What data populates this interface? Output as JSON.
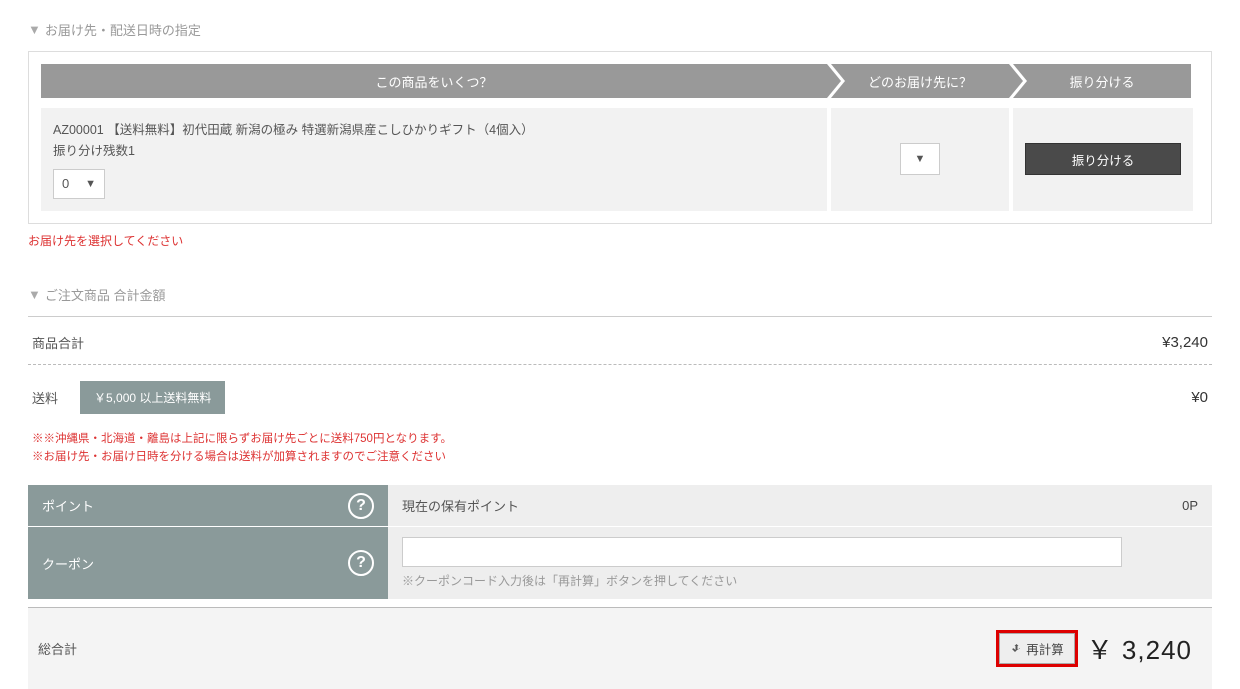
{
  "delivery": {
    "heading": "お届け先・配送日時の指定",
    "cols": {
      "c1": "この商品をいくつ？",
      "c2": "どのお届け先に？",
      "c3": "振り分ける"
    },
    "product_line": "AZ00001 【送料無料】初代田蔵 新潟の極み 特選新潟県産こしひかりギフト（4個入）",
    "remaining_label": "振り分け残数1",
    "qty_value": "0",
    "distribute_btn": "振り分ける",
    "error": "お届け先を選択してください"
  },
  "order": {
    "heading": "ご注文商品 合計金額",
    "subtotal_label": "商品合計",
    "subtotal_value": "¥3,240",
    "shipping_label": "送料",
    "shipping_badge": "￥5,000 以上送料無料",
    "shipping_value": "¥0",
    "note1": "※※沖縄県・北海道・離島は上記に限らずお届け先ごとに送料750円となります。",
    "note2": "※お届け先・お届け日時を分ける場合は送料が加算されますのでご注意ください",
    "points_label": "ポイント",
    "points_text": "現在の保有ポイント",
    "points_value": "0P",
    "coupon_label": "クーポン",
    "coupon_note": "※クーポンコード入力後は「再計算」ボタンを押してください",
    "total_label": "総合計",
    "recalc_label": "再計算",
    "total_value": "￥ 3,240"
  }
}
